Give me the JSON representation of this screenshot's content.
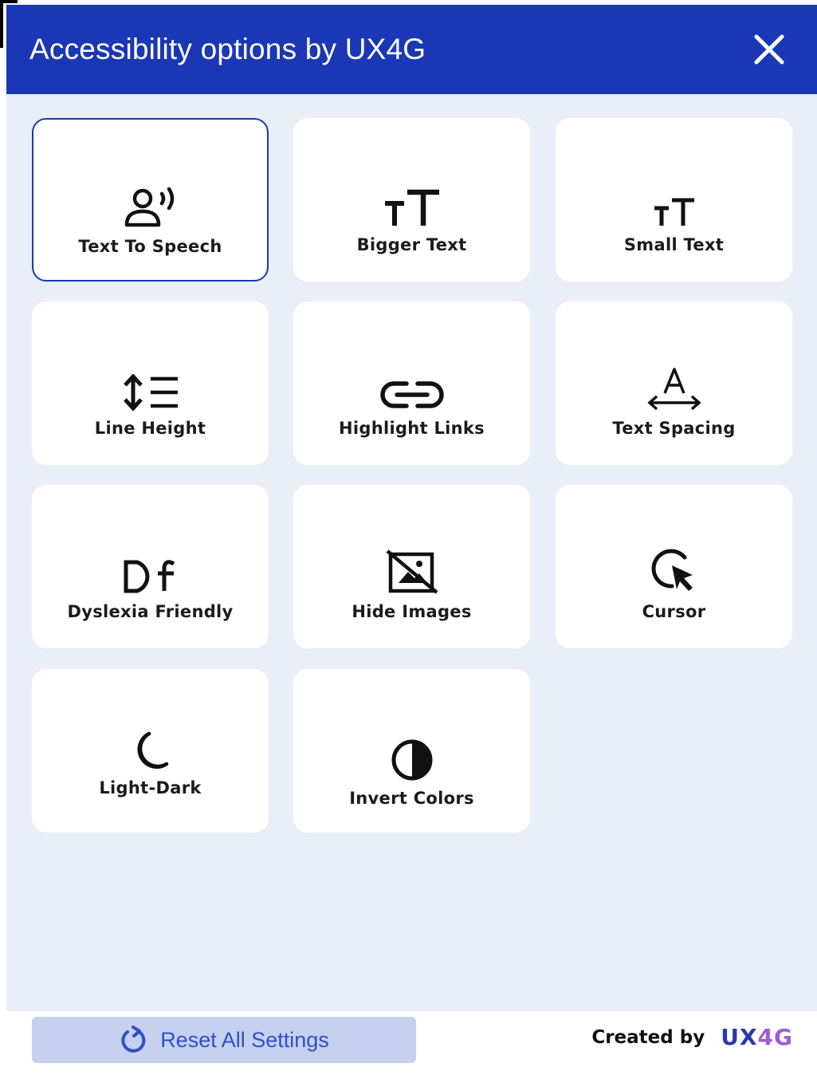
{
  "header": {
    "title": "Accessibility options by UX4G",
    "close_icon": "close-icon"
  },
  "options": [
    {
      "label": "Text To Speech",
      "icon": "speaking-person-icon",
      "active": true
    },
    {
      "label": "Bigger Text",
      "icon": "bigger-text-icon",
      "active": false
    },
    {
      "label": "Small Text",
      "icon": "small-text-icon",
      "active": false
    },
    {
      "label": "Line Height",
      "icon": "line-height-icon",
      "active": false
    },
    {
      "label": "Highlight Links",
      "icon": "link-icon",
      "active": false
    },
    {
      "label": "Text Spacing",
      "icon": "text-spacing-icon",
      "active": false
    },
    {
      "label": "Dyslexia Friendly",
      "icon": "dyslexia-df-icon",
      "active": false
    },
    {
      "label": "Hide Images",
      "icon": "hide-image-icon",
      "active": false
    },
    {
      "label": "Cursor",
      "icon": "cursor-icon",
      "active": false
    },
    {
      "label": "Light-Dark",
      "icon": "moon-icon",
      "active": false
    },
    {
      "label": "Invert Colors",
      "icon": "contrast-icon",
      "active": false
    }
  ],
  "footer": {
    "reset_label": "Reset All Settings",
    "reset_icon": "refresh-icon",
    "credit_text": "Created by",
    "brand_ux": "UX",
    "brand_4g": "4G"
  },
  "colors": {
    "header_bg": "#1a38b5",
    "body_bg": "#eaeef7",
    "active_border": "#1a38b5",
    "reset_bg": "#c6d0ef",
    "reset_text": "#3050c8",
    "brand_ux": "#2838b0",
    "brand_4g": "#a05ad8"
  }
}
